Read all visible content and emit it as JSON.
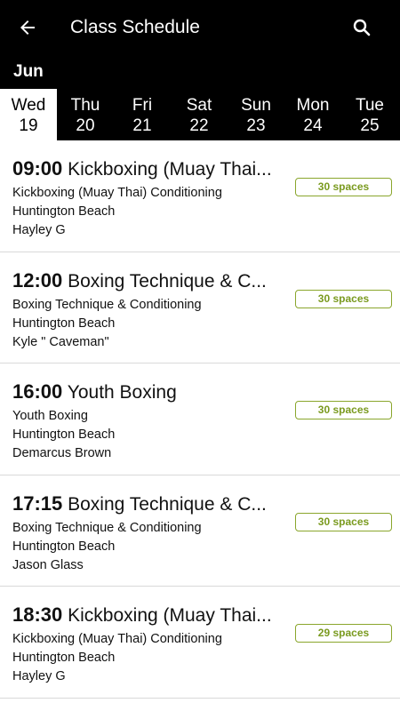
{
  "header": {
    "title": "Class Schedule",
    "back_icon": "back-arrow-icon",
    "search_icon": "search-icon"
  },
  "month": "Jun",
  "days": [
    {
      "dow": "Wed",
      "num": "19",
      "selected": true
    },
    {
      "dow": "Thu",
      "num": "20"
    },
    {
      "dow": "Fri",
      "num": "21"
    },
    {
      "dow": "Sat",
      "num": "22"
    },
    {
      "dow": "Sun",
      "num": "23"
    },
    {
      "dow": "Mon",
      "num": "24"
    },
    {
      "dow": "Tue",
      "num": "25"
    }
  ],
  "classes": [
    {
      "time": "09:00",
      "name": "Kickboxing (Muay Thai...",
      "type": "Kickboxing (Muay Thai) Conditioning",
      "location": "Huntington Beach",
      "instructor": "Hayley G",
      "spaces": "30 spaces"
    },
    {
      "time": "12:00",
      "name": "Boxing Technique & C...",
      "type": "Boxing Technique & Conditioning",
      "location": "Huntington Beach",
      "instructor": "Kyle \" Caveman\"",
      "spaces": "30 spaces"
    },
    {
      "time": "16:00",
      "name": "Youth Boxing",
      "type": "Youth Boxing",
      "location": "Huntington Beach",
      "instructor": "Demarcus Brown",
      "spaces": "30 spaces"
    },
    {
      "time": "17:15",
      "name": "Boxing Technique & C...",
      "type": "Boxing Technique & Conditioning",
      "location": "Huntington Beach",
      "instructor": "Jason Glass",
      "spaces": "30 spaces"
    },
    {
      "time": "18:30",
      "name": "Kickboxing (Muay Thai...",
      "type": "Kickboxing (Muay Thai) Conditioning",
      "location": "Huntington Beach",
      "instructor": "Hayley G",
      "spaces": "29 spaces"
    }
  ],
  "colors": {
    "header_bg": "#000000",
    "badge_accent": "#8aa62c",
    "selected_day_bg": "#ffffff"
  }
}
